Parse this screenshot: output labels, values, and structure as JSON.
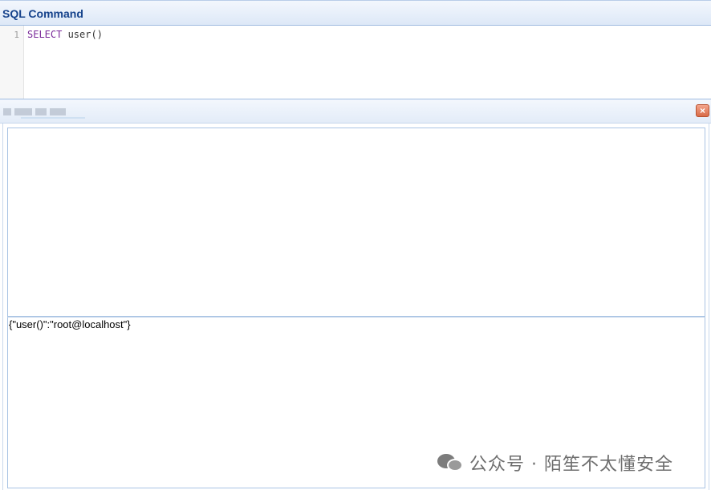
{
  "sql_panel": {
    "title": "SQL Command",
    "line_number": "1",
    "keyword": "SELECT",
    "code_rest": " user()"
  },
  "result_panel": {
    "close_glyph": "×",
    "result_text": "{\"user()\":\"root@localhost\"}"
  },
  "watermark": {
    "text": "公众号 · 陌笙不太懂安全"
  },
  "colors": {
    "header_text": "#15428b",
    "keyword": "#7a2a9a",
    "close_button": "#d86b48"
  },
  "icons": {
    "close": "close-icon",
    "wechat": "wechat-icon"
  }
}
